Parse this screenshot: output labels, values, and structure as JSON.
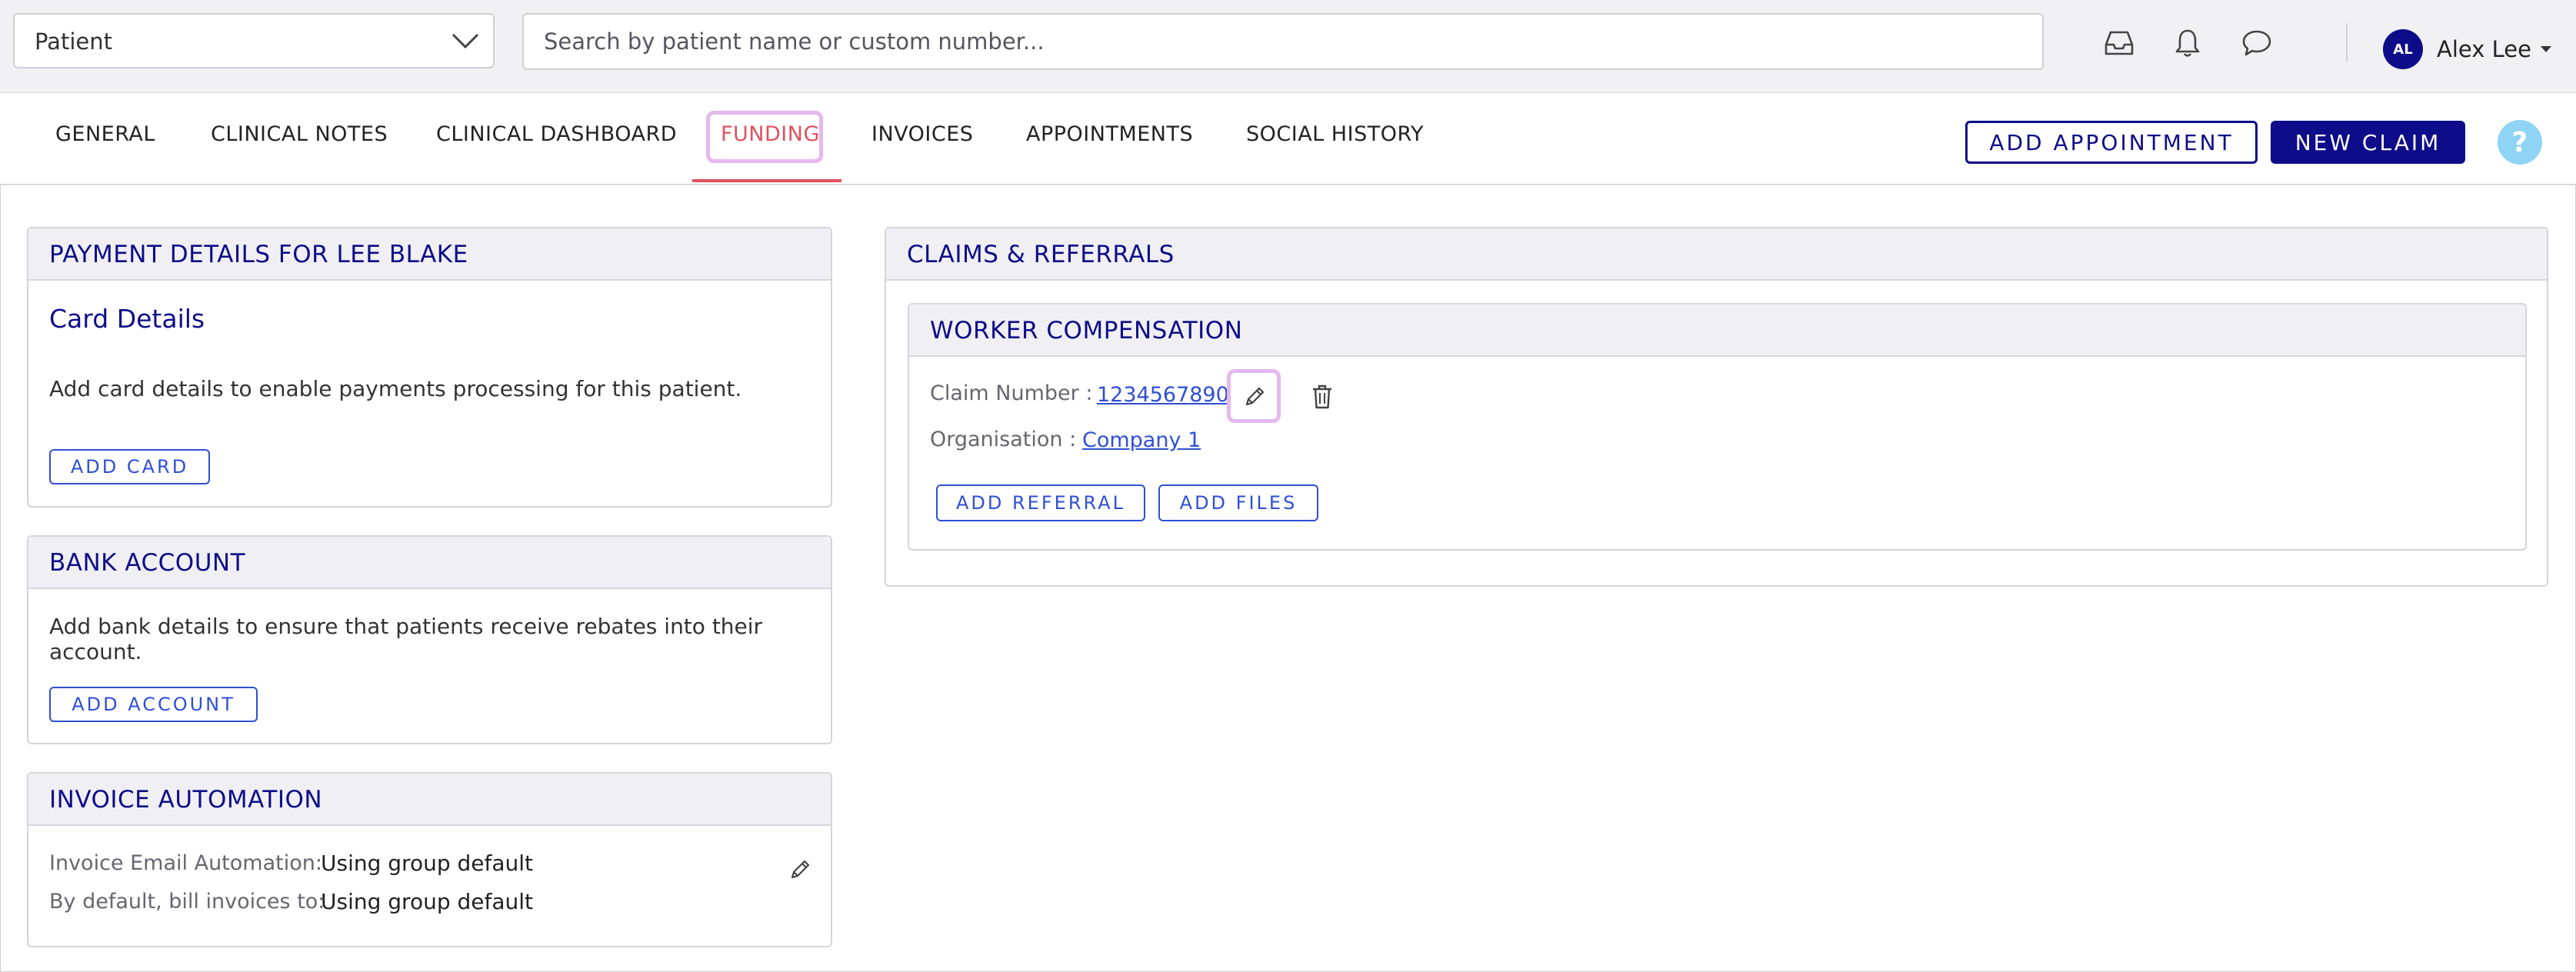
{
  "topbar": {
    "patient_select_value": "Patient",
    "search_placeholder": "Search by patient name or custom number...",
    "user": {
      "initials": "AL",
      "name": "Alex Lee"
    }
  },
  "tabs": [
    {
      "label": "GENERAL"
    },
    {
      "label": "CLINICAL NOTES"
    },
    {
      "label": "CLINICAL DASHBOARD"
    },
    {
      "label": "FUNDING",
      "active": true
    },
    {
      "label": "INVOICES"
    },
    {
      "label": "APPOINTMENTS"
    },
    {
      "label": "SOCIAL HISTORY"
    }
  ],
  "actions": {
    "add_appointment": "ADD APPOINTMENT",
    "new_claim": "NEW CLAIM",
    "help": "?"
  },
  "payment": {
    "title": "PAYMENT DETAILS FOR LEE BLAKE",
    "card_title": "Card Details",
    "card_text": "Add card details to enable payments processing for this patient.",
    "add_card": "ADD CARD"
  },
  "bank": {
    "title": "BANK ACCOUNT",
    "text": "Add bank details to ensure that patients receive rebates into their account.",
    "add_account": "ADD ACCOUNT"
  },
  "invoice_automation": {
    "title": "INVOICE AUTOMATION",
    "email_label": "Invoice Email Automation:",
    "email_value": "Using group default",
    "bill_label": "By default, bill invoices to:",
    "bill_value": "Using group default"
  },
  "claims": {
    "title": "CLAIMS & REFERRALS",
    "claim": {
      "type": "WORKER COMPENSATION",
      "claim_number_label": "Claim Number :",
      "claim_number": "1234567890",
      "organisation_label": "Organisation :",
      "organisation": "Company 1",
      "add_referral": "ADD REFERRAL",
      "add_files": "ADD FILES"
    }
  },
  "colors": {
    "primary": "#0d0d8a",
    "link": "#2f4fd6",
    "active_tab": "#e0525e",
    "highlight": "#e6b8ef",
    "help": "#8fd3f5"
  }
}
